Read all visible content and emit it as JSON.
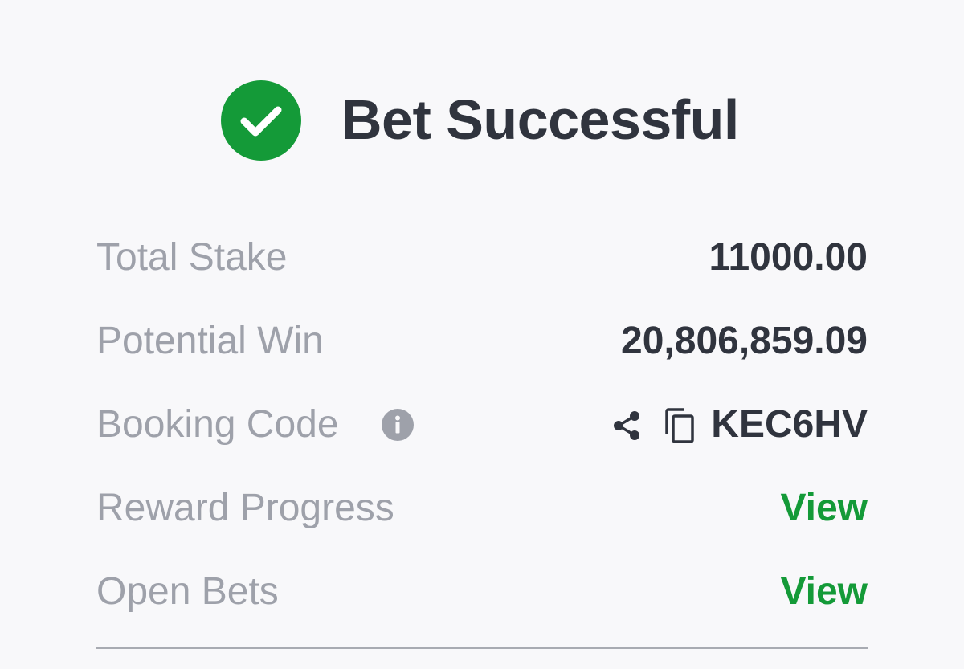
{
  "header": {
    "title": "Bet Successful",
    "icon": "check-circle-icon",
    "accent_color": "#149a38"
  },
  "summary": {
    "total_stake": {
      "label": "Total Stake",
      "value": "11000.00"
    },
    "potential_win": {
      "label": "Potential Win",
      "value": "20,806,859.09"
    },
    "booking_code": {
      "label": "Booking Code",
      "info_icon": "info-icon",
      "share_icon": "share-icon",
      "copy_icon": "copy-icon",
      "value": "KEC6HV"
    },
    "reward_progress": {
      "label": "Reward Progress",
      "link": "View"
    },
    "open_bets": {
      "label": "Open Bets",
      "link": "View"
    }
  },
  "colors": {
    "background": "#f8f8fa",
    "text_dark": "#30343e",
    "text_muted": "#9ea1aa",
    "link_green": "#149a38"
  }
}
